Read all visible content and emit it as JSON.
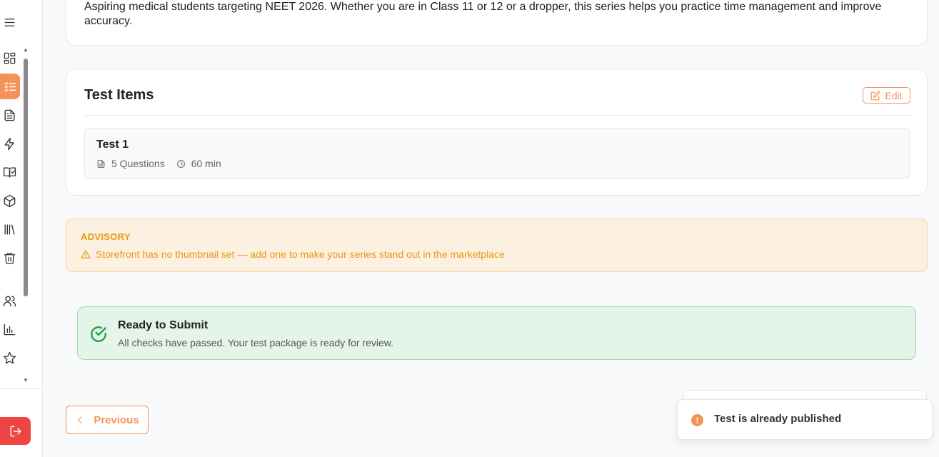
{
  "sidebar": {
    "items": [
      {
        "name": "menu-icon"
      },
      {
        "name": "dashboard-icon"
      },
      {
        "name": "list-check-icon",
        "active": true
      },
      {
        "name": "document-icon"
      },
      {
        "name": "lightning-icon"
      },
      {
        "name": "book-check-icon"
      },
      {
        "name": "package-icon"
      },
      {
        "name": "library-icon"
      },
      {
        "name": "trash-icon"
      },
      {
        "name": "users-icon"
      },
      {
        "name": "bar-chart-icon"
      },
      {
        "name": "star-icon"
      },
      {
        "name": "logout-icon"
      }
    ],
    "active_color": "#f5925a",
    "logout_color": "#ef4444"
  },
  "description": {
    "text": "Aspiring medical students targeting NEET 2026. Whether you are in Class 11 or 12 or a dropper, this series helps you practice time management and improve accuracy."
  },
  "test_items": {
    "title": "Test Items",
    "edit_label": "Edit",
    "items": [
      {
        "name": "Test 1",
        "questions": "5 Questions",
        "duration": "60 min"
      }
    ]
  },
  "advisory": {
    "title": "ADVISORY",
    "message": "Storefront has no thumbnail set — add one to make your series stand out in the marketplace"
  },
  "ready": {
    "title": "Ready to Submit",
    "subtitle": "All checks have passed. Your test package is ready for review."
  },
  "navigation": {
    "previous_label": "Previous"
  },
  "toast": {
    "message": "Test is already published",
    "icon": "!"
  }
}
